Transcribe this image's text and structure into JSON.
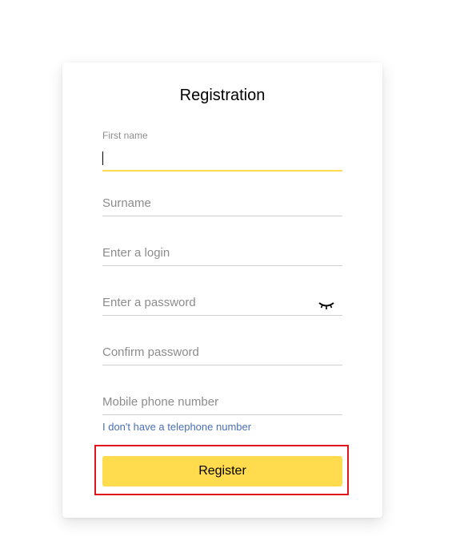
{
  "form": {
    "title": "Registration",
    "fields": [
      {
        "label": "First name",
        "value": "",
        "placeholder": ""
      },
      {
        "placeholder": "Surname",
        "value": ""
      },
      {
        "placeholder": "Enter a login",
        "value": ""
      },
      {
        "placeholder": "Enter a password",
        "value": ""
      },
      {
        "placeholder": "Confirm password",
        "value": ""
      },
      {
        "placeholder": "Mobile phone number",
        "value": ""
      }
    ],
    "no_phone_link": "I don't have a telephone number",
    "register_label": "Register"
  },
  "colors": {
    "accent": "#ffdb4d",
    "link": "#4a6fb5",
    "highlight": "#e2121a"
  },
  "icons": {
    "password_toggle": "eye-closed-icon"
  }
}
